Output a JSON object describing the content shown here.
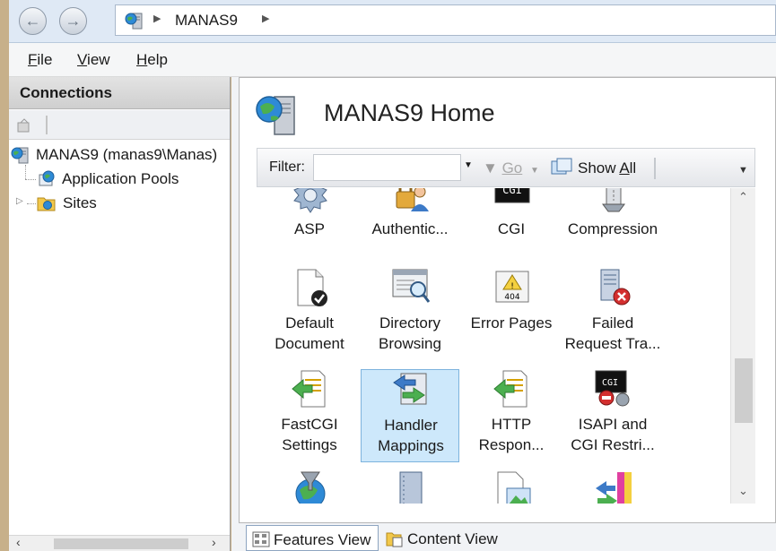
{
  "address": {
    "server": "MANAS9"
  },
  "menu": {
    "file": "File",
    "view": "View",
    "help": "Help"
  },
  "connections": {
    "title": "Connections",
    "tree": {
      "server": "MANAS9 (manas9\\Manas)",
      "app_pools": "Application Pools",
      "sites": "Sites"
    }
  },
  "main": {
    "title": "MANAS9 Home",
    "filter": {
      "label": "Filter:",
      "value": "",
      "go": "Go",
      "show_all": "Show All"
    },
    "features": [
      {
        "line1": "ASP",
        "line2": "",
        "icon": "asp-icon"
      },
      {
        "line1": "Authentic...",
        "line2": "",
        "icon": "authentication-icon"
      },
      {
        "line1": "CGI",
        "line2": "",
        "icon": "cgi-icon"
      },
      {
        "line1": "Compression",
        "line2": "",
        "icon": "compression-icon"
      },
      {
        "line1": "Default",
        "line2": "Document",
        "icon": "default-document-icon"
      },
      {
        "line1": "Directory",
        "line2": "Browsing",
        "icon": "directory-browsing-icon"
      },
      {
        "line1": "Error Pages",
        "line2": "",
        "icon": "error-pages-icon"
      },
      {
        "line1": "Failed",
        "line2": "Request Tra...",
        "icon": "failed-request-icon"
      },
      {
        "line1": "FastCGI",
        "line2": "Settings",
        "icon": "fastcgi-icon"
      },
      {
        "line1": "Handler",
        "line2": "Mappings",
        "icon": "handler-mappings-icon"
      },
      {
        "line1": "HTTP",
        "line2": "Respon...",
        "icon": "http-response-icon"
      },
      {
        "line1": "ISAPI and",
        "line2": "CGI Restri...",
        "icon": "isapi-cgi-icon"
      },
      {
        "line1": "",
        "line2": "",
        "icon": "globe-filter-icon"
      },
      {
        "line1": "",
        "line2": "",
        "icon": "notebook-icon"
      },
      {
        "line1": "",
        "line2": "",
        "icon": "mime-image-icon"
      },
      {
        "line1": "",
        "line2": "",
        "icon": "modules-icon"
      }
    ],
    "selected_feature": "Handler Mappings"
  },
  "tabs": {
    "features": "Features View",
    "content": "Content View"
  },
  "colors": {
    "selection_bg": "#cde8fb",
    "selection_border": "#7db3dd",
    "address_bar": "#dfe9f5"
  }
}
